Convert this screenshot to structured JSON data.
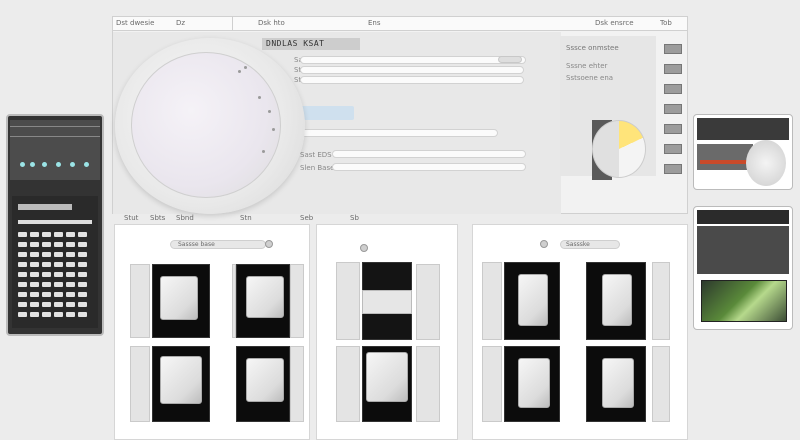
{
  "tabs": [
    {
      "label": "Dst dwesie"
    },
    {
      "label": "Dz"
    },
    {
      "label": "Dsk hto"
    },
    {
      "label": "Ens"
    },
    {
      "label": "Dsk ensrce"
    },
    {
      "label": "Tob"
    }
  ],
  "main": {
    "heading": "DNDLAS KSAT",
    "fields": [
      "Sassle ll7L",
      "Stsum Bed",
      "Stoss lsed"
    ],
    "small_labels": [
      "Sast EDS",
      "Slen Base"
    ],
    "right_col_title": "Sssce onmstee",
    "right_col_lines": [
      "Sssne ehter",
      "Sstsoene ena"
    ]
  },
  "left_device": {
    "keys_rows": 9
  },
  "bottom": {
    "left_tab_labels": [
      "Stut",
      "Sbts",
      "Sbnd",
      "Stn",
      "Seb",
      "Sb"
    ],
    "left_bar_label": "Sassse base",
    "right_bar_label": "Sassske"
  },
  "colors": {
    "accent_yellow": "#ffe47a",
    "accent_teal": "#9be4e6",
    "accent_blue": "#cfe0ee"
  }
}
